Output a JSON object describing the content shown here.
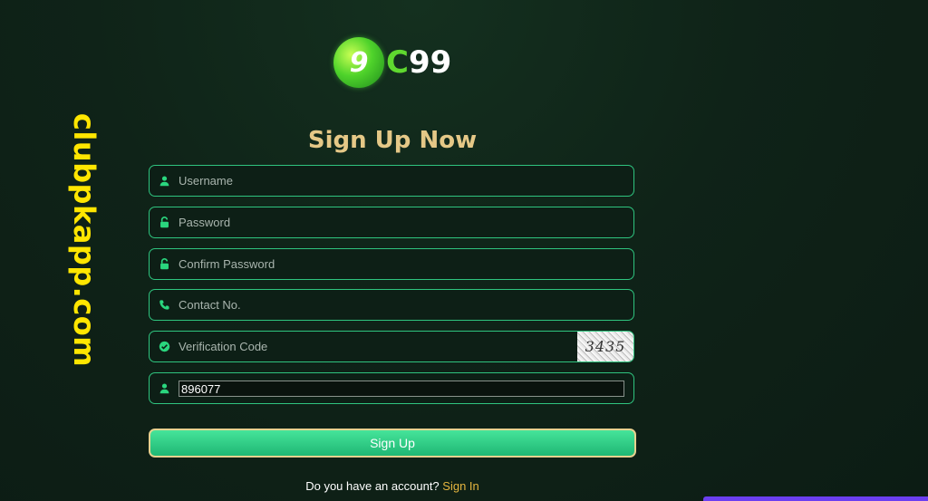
{
  "watermark": "clubpkapp.com",
  "logo": {
    "mark": "9",
    "text_c": "C",
    "text_num": "99"
  },
  "title": "Sign Up Now",
  "fields": {
    "username": {
      "placeholder": "Username",
      "icon": "user-icon"
    },
    "password": {
      "placeholder": "Password",
      "icon": "lock-icon"
    },
    "confirm_password": {
      "placeholder": "Confirm Password",
      "icon": "lock-icon"
    },
    "contact": {
      "placeholder": "Contact No.",
      "icon": "phone-icon"
    },
    "verification": {
      "placeholder": "Verification Code",
      "icon": "check-circle-icon",
      "captcha": "3435"
    },
    "referral": {
      "value": "896077",
      "icon": "user-icon"
    }
  },
  "signup_button": "Sign Up",
  "footer": {
    "prompt": "Do you have an account?",
    "link": "Sign In"
  },
  "colors": {
    "accent": "#2fc47f",
    "title": "#e5c887",
    "watermark": "#ffe600",
    "link": "#e5b53f",
    "background": "#0f2318"
  }
}
